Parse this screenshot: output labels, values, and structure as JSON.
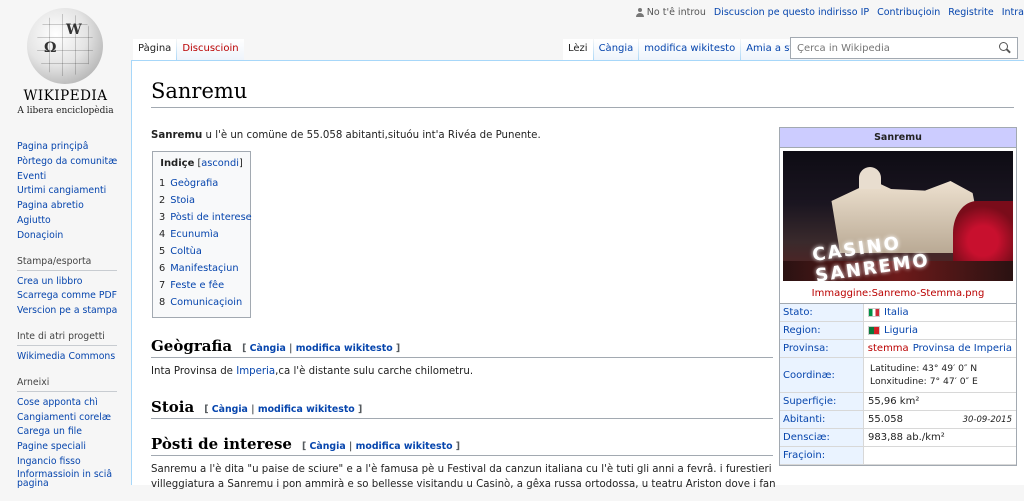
{
  "logo": {
    "wordmark": "WIKIPEDIA",
    "tagline": "A libera enciclopèdia"
  },
  "personal": {
    "not_logged": "No t'ê introu",
    "talk": "Discuscion pe questo indirisso IP",
    "contributions": "Contribuçioin",
    "register": "Registrite",
    "login": "Intra"
  },
  "tabs": {
    "page": "Pàgina",
    "talk": "Discuscioin",
    "read": "Lèzi",
    "edit": "Càngia",
    "edit_source": "modifica wikitesto",
    "history": "Amia a stoia"
  },
  "search": {
    "placeholder": "Çerca in Wikipedia"
  },
  "sidebar": {
    "nav": [
      "Pagina prinçipâ",
      "Pòrtego da comunitæ",
      "Eventi",
      "Urtimi cangiamenti",
      "Pagina abretio",
      "Agiutto",
      "Donaçioin"
    ],
    "print_title": "Stampa/esporta",
    "print": [
      "Crea un libbro",
      "Scarrega comme PDF",
      "Verscion pe a stampa"
    ],
    "projects_title": "Inte di atri progetti",
    "projects": [
      "Wikimedia Commons"
    ],
    "tools_title": "Arneixi",
    "tools": [
      "Cose apponta chì",
      "Cangiamenti corelæ",
      "Carega un file",
      "Pagine speciali",
      "Ingancio fisso",
      "Informassioin in sciâ pagina"
    ]
  },
  "article": {
    "title": "Sanremu",
    "intro_bold": "Sanremu",
    "intro_rest": " u l'è un comüne de 55.058 abitanti,situóu int'a Rivéa de Punente.",
    "toc": {
      "title": "Indiçe",
      "toggle": "ascondi",
      "items": [
        {
          "n": "1",
          "label": "Geògrafia"
        },
        {
          "n": "2",
          "label": "Stoia"
        },
        {
          "n": "3",
          "label": "Pòsti de interese"
        },
        {
          "n": "4",
          "label": "Ecunumìa"
        },
        {
          "n": "5",
          "label": "Coltùa"
        },
        {
          "n": "6",
          "label": "Manifestaçiun"
        },
        {
          "n": "7",
          "label": "Feste e fêe"
        },
        {
          "n": "8",
          "label": "Comunicaçioin"
        }
      ]
    },
    "sections": {
      "geo": {
        "title": "Geògrafia",
        "edit": "Càngia",
        "edit_src": "modifica wikitesto",
        "text_a": "Inta Provinsa de ",
        "text_link": "Imperia",
        "text_b": ",ca l'è distante sulu carche chilometru."
      },
      "stoia": {
        "title": "Stoia",
        "edit": "Càngia",
        "edit_src": "modifica wikitesto"
      },
      "posti": {
        "title": "Pòsti de interese",
        "edit": "Càngia",
        "edit_src": "modifica wikitesto",
        "line1": "Sanremu a l'è dita \"u paise de sciure\" e a l'è famusa pè u Festival da canzun italiana cu l'è tuti gli anni a fevrâ. i furestieri chi ven in",
        "line2": "villeggiatura a Sanremu i pon ammirà e so bellesse visitandu u Casinò, a gêxa russa ortodossa, u teatru Ariston dove i fan u"
      }
    }
  },
  "infobox": {
    "title": "Sanremu",
    "caption": "Immaggine:Sanremo-Stemma.png",
    "image_sign": "CASINO SANREMO",
    "rows": {
      "stato": {
        "k": "Stato:",
        "v": "Italia"
      },
      "region": {
        "k": "Region:",
        "v": "Liguria"
      },
      "provinsa": {
        "k": "Provinsa:",
        "v_red": "stemma",
        "v": "Provinsa de Imperia"
      },
      "coord": {
        "k": "Coordinæ:",
        "lat": "Latitudine: 43° 49′ 0″ N",
        "lon": "Lonxitudine: 7° 47′ 0″ E"
      },
      "sup": {
        "k": "Superfiçie:",
        "v": "55,96 km²"
      },
      "ab": {
        "k": "Abitanti:",
        "v": "55.058",
        "date": "30-09-2015"
      },
      "dens": {
        "k": "Densciæ:",
        "v": "983,88 ab./km²"
      },
      "fraz": {
        "k": "Fraçioin:",
        "v": ""
      }
    }
  }
}
